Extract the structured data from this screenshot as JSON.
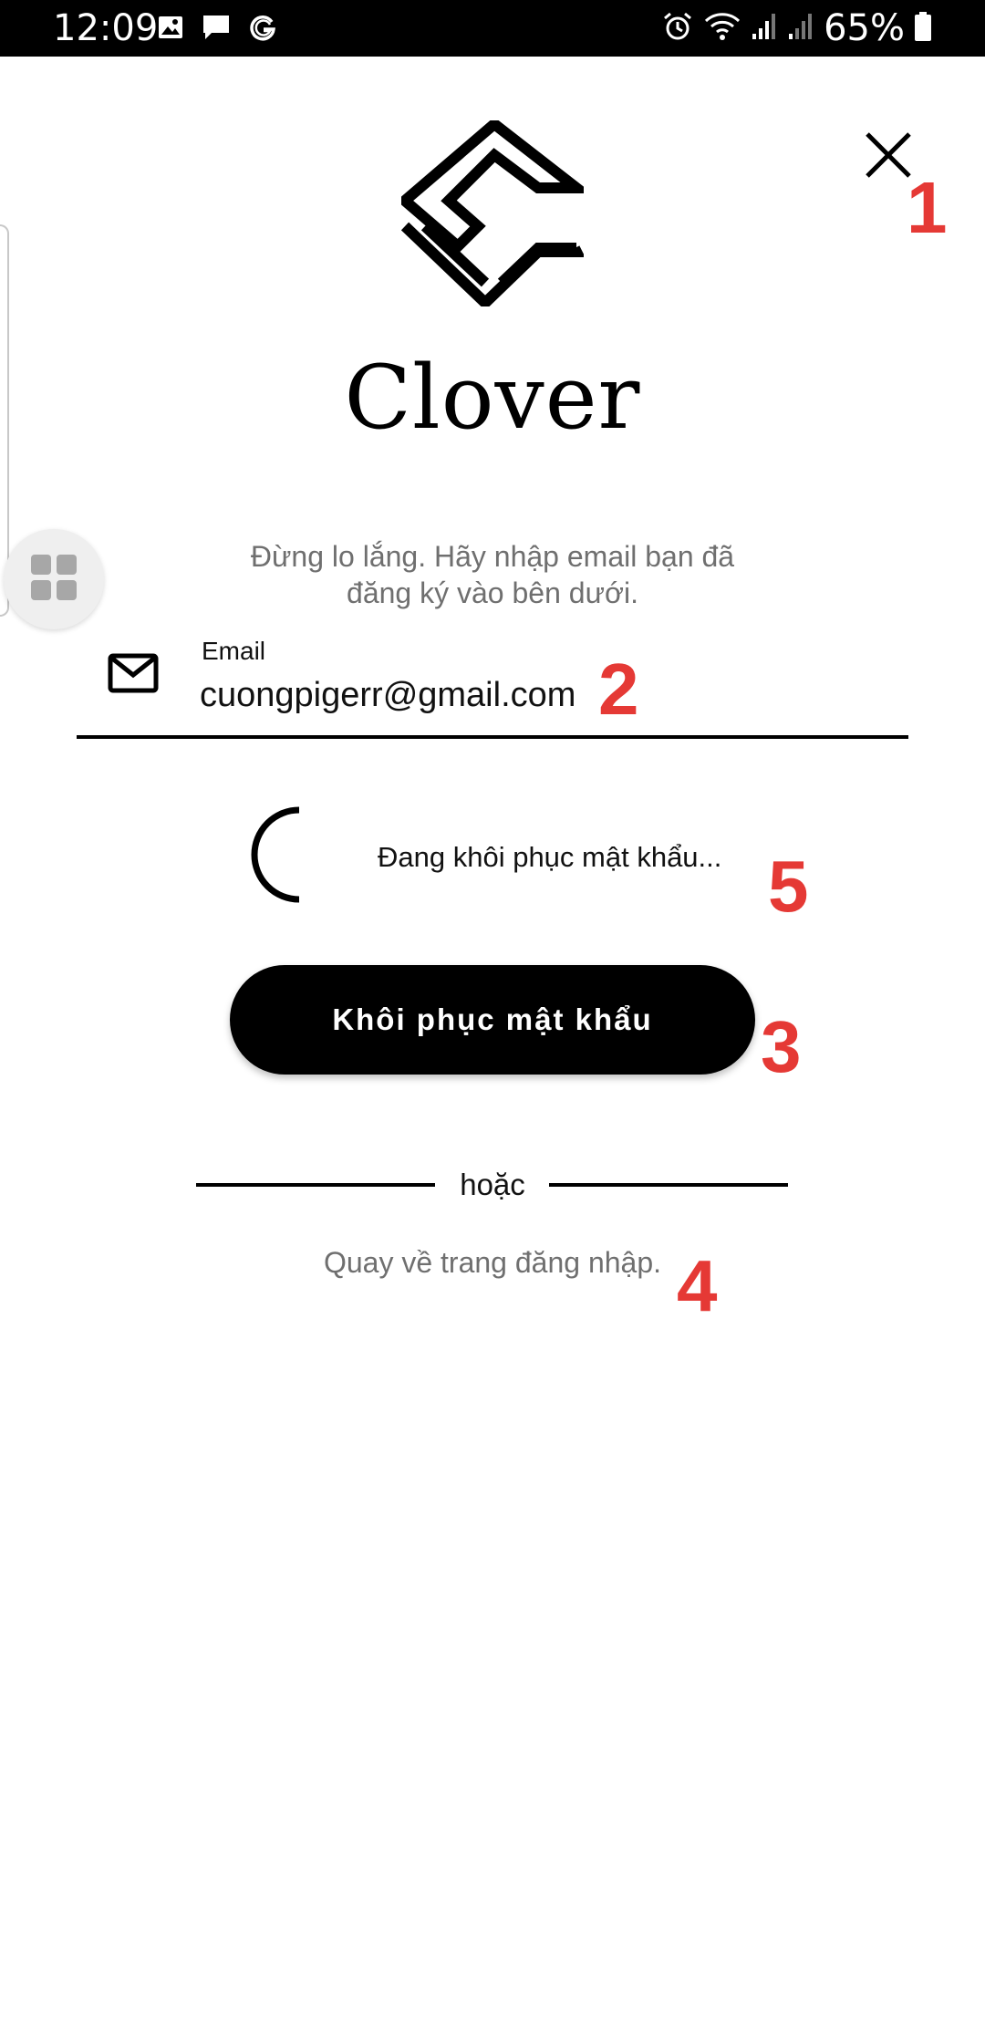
{
  "status_bar": {
    "time": "12:09",
    "battery_percent": "65%",
    "icons": [
      "image-icon",
      "message-icon",
      "g-icon",
      "alarm-icon",
      "wifi-icon",
      "signal-icon",
      "signal-icon",
      "battery-icon"
    ]
  },
  "brand": {
    "name": "Clover"
  },
  "form": {
    "subtitle_line1": "Đừng lo lắng. Hãy nhập email bạn đã",
    "subtitle_line2": "đăng ký vào bên dưới.",
    "email_label": "Email",
    "email_value": "cuongpigerr@gmail.com",
    "loading_text": "Đang khôi phục mật khẩu...",
    "submit_label": "Khôi phục mật khẩu",
    "divider_text": "hoặc",
    "back_link": "Quay về trang đăng nhập."
  },
  "annotations": [
    "1",
    "2",
    "3",
    "4",
    "5"
  ],
  "colors": {
    "accent": "#000000",
    "annotation": "#e53935",
    "muted_text": "#6f6f6f"
  }
}
